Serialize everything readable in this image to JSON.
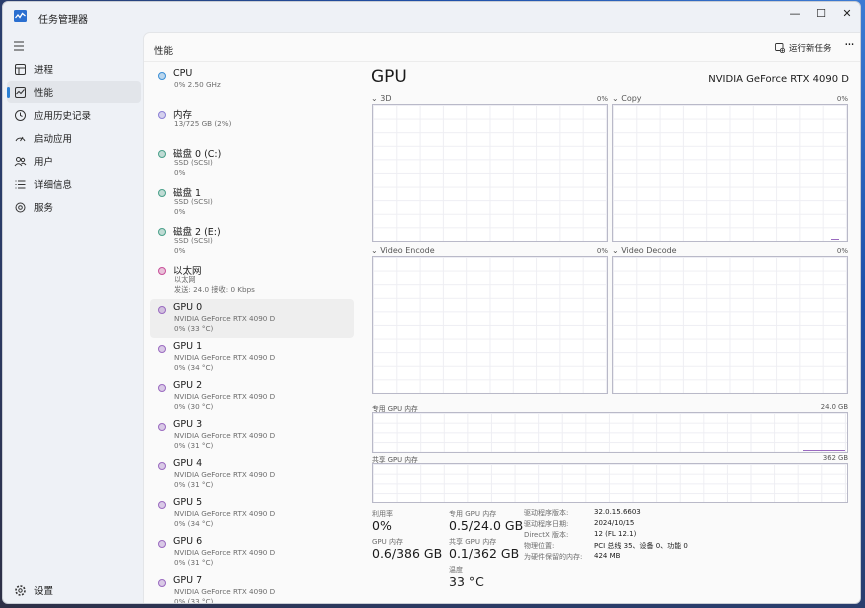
{
  "window": {
    "title": "任务管理器",
    "minimize": "—",
    "maximize": "☐",
    "close": "✕"
  },
  "sidebar": {
    "items": [
      {
        "label": "进程",
        "icon": "processes-icon"
      },
      {
        "label": "性能",
        "icon": "performance-icon"
      },
      {
        "label": "应用历史记录",
        "icon": "app-history-icon"
      },
      {
        "label": "启动应用",
        "icon": "startup-icon"
      },
      {
        "label": "用户",
        "icon": "users-icon"
      },
      {
        "label": "详细信息",
        "icon": "details-icon"
      },
      {
        "label": "服务",
        "icon": "services-icon"
      }
    ],
    "active_index": 1,
    "settings_label": "设置"
  },
  "header": {
    "title": "性能",
    "run_task_label": "运行新任务",
    "more_label": "···"
  },
  "devices": [
    {
      "name": "CPU",
      "lines": [
        "0% 2.50 GHz"
      ],
      "color": "#3b8fd6"
    },
    {
      "name": "内存",
      "lines": [
        "13/725 GB (2%)"
      ],
      "color": "#8a7fd6"
    },
    {
      "name": "磁盘 0 (C:)",
      "lines": [
        "SSD (SCSI)",
        "0%"
      ],
      "color": "#4aa08a"
    },
    {
      "name": "磁盘 1",
      "lines": [
        "SSD (SCSI)",
        "0%"
      ],
      "color": "#4aa08a"
    },
    {
      "name": "磁盘 2 (E:)",
      "lines": [
        "SSD (SCSI)",
        "0%"
      ],
      "color": "#4aa08a"
    },
    {
      "name": "以太网",
      "lines": [
        "以太网",
        "发送: 24.0 接收: 0 Kbps"
      ],
      "color": "#c8509a"
    },
    {
      "name": "GPU 0",
      "lines": [
        "NVIDIA GeForce RTX 4090 D",
        "0% (33 °C)"
      ],
      "color": "#9a6ac0"
    },
    {
      "name": "GPU 1",
      "lines": [
        "NVIDIA GeForce RTX 4090 D",
        "0% (34 °C)"
      ],
      "color": "#9a6ac0"
    },
    {
      "name": "GPU 2",
      "lines": [
        "NVIDIA GeForce RTX 4090 D",
        "0% (30 °C)"
      ],
      "color": "#9a6ac0"
    },
    {
      "name": "GPU 3",
      "lines": [
        "NVIDIA GeForce RTX 4090 D",
        "0% (31 °C)"
      ],
      "color": "#9a6ac0"
    },
    {
      "name": "GPU 4",
      "lines": [
        "NVIDIA GeForce RTX 4090 D",
        "0% (31 °C)"
      ],
      "color": "#9a6ac0"
    },
    {
      "name": "GPU 5",
      "lines": [
        "NVIDIA GeForce RTX 4090 D",
        "0% (34 °C)"
      ],
      "color": "#9a6ac0"
    },
    {
      "name": "GPU 6",
      "lines": [
        "NVIDIA GeForce RTX 4090 D",
        "0% (31 °C)"
      ],
      "color": "#9a6ac0"
    },
    {
      "name": "GPU 7",
      "lines": [
        "NVIDIA GeForce RTX 4090 D",
        "0% (33 °C)"
      ],
      "color": "#9a6ac0"
    }
  ],
  "selected_device": 6,
  "detail": {
    "title": "GPU",
    "model": "NVIDIA GeForce RTX 4090 D",
    "engines": [
      {
        "label": "3D",
        "value": "0%"
      },
      {
        "label": "Copy",
        "value": "0%"
      },
      {
        "label": "Video Encode",
        "value": "0%"
      },
      {
        "label": "Video Decode",
        "value": "0%"
      }
    ],
    "dedicated_mem_label": "专用 GPU 内存",
    "dedicated_mem_max": "24.0 GB",
    "shared_mem_label": "共享 GPU 内存",
    "shared_mem_max": "362 GB",
    "stats": {
      "utilization_label": "利用率",
      "utilization_value": "0%",
      "dedicated_label": "专用 GPU 内存",
      "dedicated_value": "0.5/24.0 GB",
      "gpu_mem_label": "GPU 内存",
      "gpu_mem_value": "0.6/386 GB",
      "shared_label": "共享 GPU 内存",
      "shared_value": "0.1/362 GB",
      "temp_label": "温度",
      "temp_value": "33 °C"
    },
    "info": [
      {
        "k": "驱动程序版本:",
        "v": "32.0.15.6603"
      },
      {
        "k": "驱动程序日期:",
        "v": "2024/10/15"
      },
      {
        "k": "DirectX 版本:",
        "v": "12 (FL 12.1)"
      },
      {
        "k": "物理位置:",
        "v": "PCI 总线 35、设备 0、功能 0"
      },
      {
        "k": "为硬件保留的内存:",
        "v": "424 MB"
      }
    ]
  }
}
